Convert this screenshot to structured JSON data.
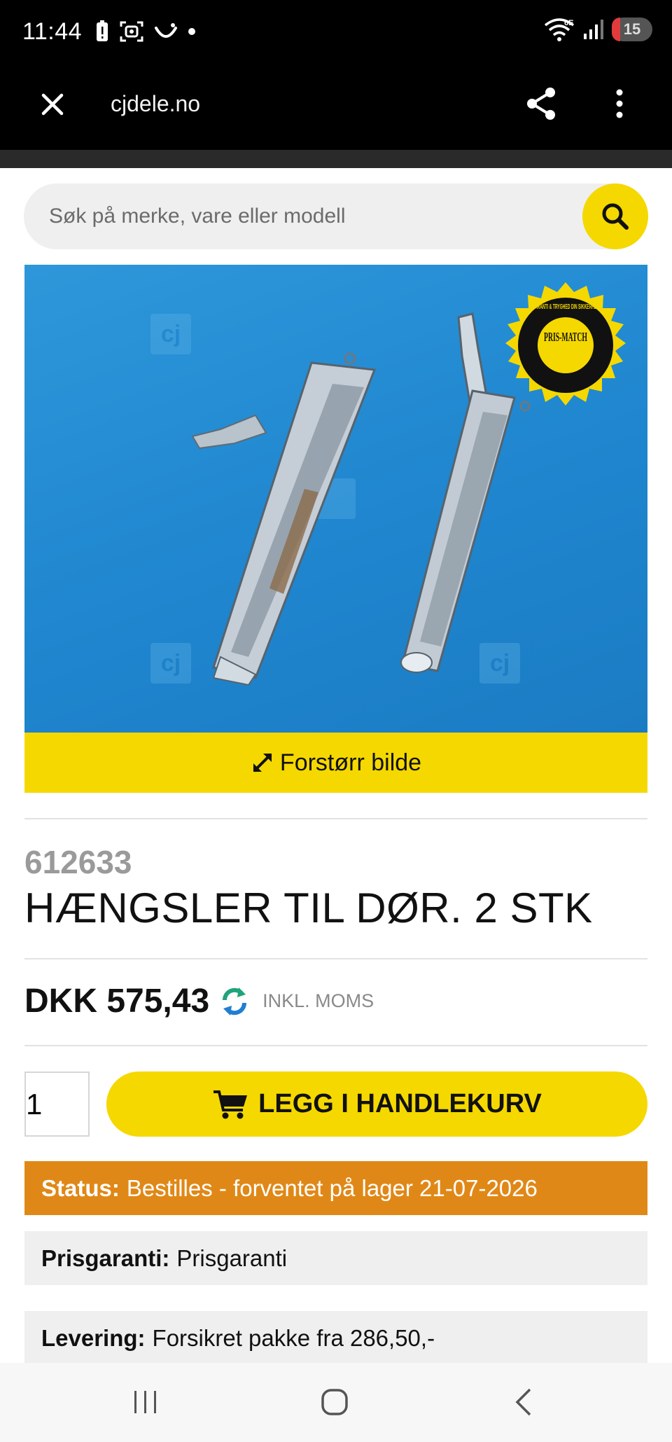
{
  "status_bar": {
    "time": "11:44",
    "network": "6E",
    "battery": "15"
  },
  "browser": {
    "url": "cjdele.no",
    "icons": [
      "close-icon",
      "share-icon",
      "more-vert-icon"
    ]
  },
  "search": {
    "placeholder": "Søk på merke, vare eller modell",
    "icon": "search-icon"
  },
  "product_image": {
    "watermark": "cj",
    "badge_ring": "GARANTI & TRYGHED DIN SIKKERHED",
    "badge_center": "PRIS-MATCH",
    "enlarge_label": "Forstørr bilde"
  },
  "product": {
    "sku": "612633",
    "title": "HÆNGSLER TIL DØR. 2 STK",
    "price": "DKK 575,43",
    "vat_label": "INKL. MOMS"
  },
  "cart": {
    "quantity": "1",
    "add_label": "LEGG I HANDLEKURV"
  },
  "status": {
    "label": "Status:",
    "value": "Bestilles - forventet på lager 21-07-2026"
  },
  "price_guarantee": {
    "label": "Prisgaranti:",
    "value": "Prisgaranti"
  },
  "delivery": {
    "label": "Levering:",
    "value": "Forsikret pakke fra 286,50,-"
  },
  "colors": {
    "accent_yellow": "#f5d800",
    "status_orange": "#e08817",
    "refresh_green": "#1fa37a",
    "refresh_blue": "#1f7fd1"
  }
}
